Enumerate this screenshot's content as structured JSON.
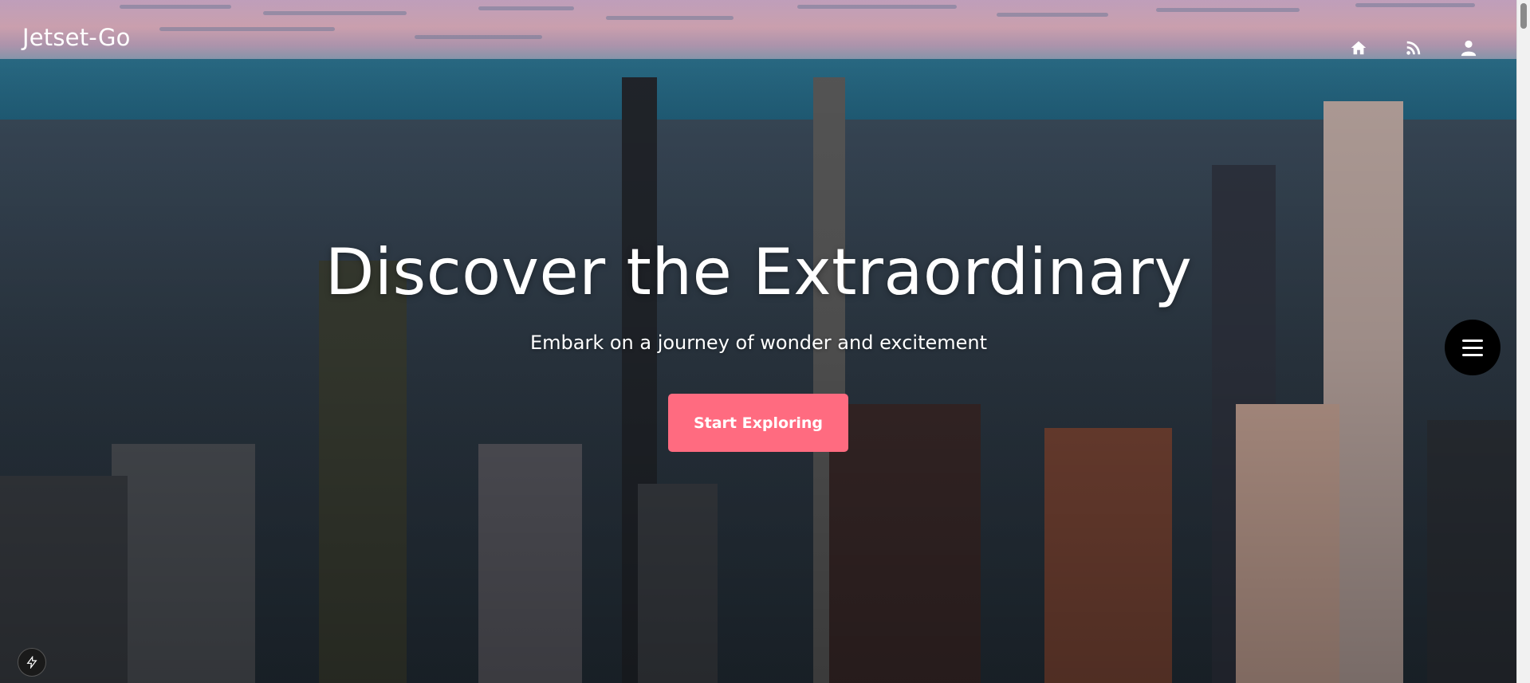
{
  "header": {
    "logo": "Jetset-Go",
    "icons": [
      "home-icon",
      "rss-icon",
      "user-icon"
    ]
  },
  "hero": {
    "title": "Discover the Extraordinary",
    "subtitle": "Embark on a journey of wonder and excitement",
    "cta_label": "Start Exploring"
  },
  "floating": {
    "menu_icon": "hamburger-menu-icon",
    "badge_icon": "lightning-bolt-icon"
  },
  "colors": {
    "cta": "#ff6b80",
    "menu_fab": "#000000",
    "text": "#ffffff"
  }
}
